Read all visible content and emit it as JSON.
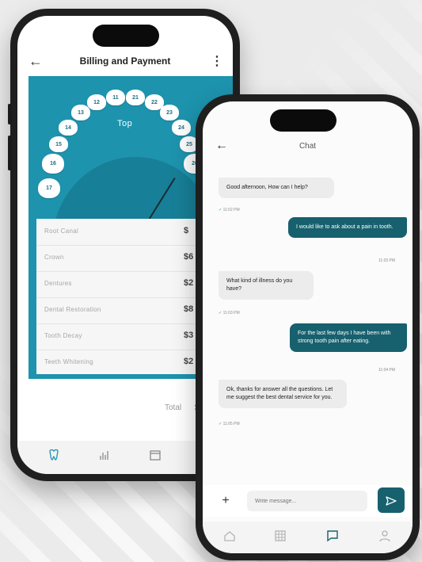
{
  "billing": {
    "title": "Billing and Payment",
    "back_icon": "arrow-left-icon",
    "more_icon": "more-vertical-icon",
    "jaw_label": "Top",
    "teeth": [
      "11",
      "12",
      "13",
      "14",
      "15",
      "16",
      "17",
      "21",
      "22",
      "23",
      "24",
      "25",
      "26"
    ],
    "services": [
      {
        "name": "Root Canal",
        "price": "$"
      },
      {
        "name": "Crown",
        "price": "$6"
      },
      {
        "name": "Dentures",
        "price": "$2"
      },
      {
        "name": "Dental Restoration",
        "price": "$8"
      },
      {
        "name": "Tooth Decay",
        "price": "$3"
      },
      {
        "name": "Teeth Whitening",
        "price": "$2"
      }
    ],
    "total_label": "Total",
    "total_value": "$1",
    "tab_icons": [
      "tooth-icon",
      "chart-icon",
      "calendar-icon"
    ],
    "accent_color": "#1d93ad"
  },
  "chat": {
    "title": "Chat",
    "back_icon": "arrow-left-icon",
    "messages": [
      {
        "from": "them",
        "text": "Good afternoon, How can I help?",
        "time": "11:02 PM"
      },
      {
        "from": "me",
        "text": "I would like to ask about a pain in tooth.",
        "time": "11:03 PM"
      },
      {
        "from": "them",
        "text": "What kind of illness do you have?",
        "time": "11:03 PM"
      },
      {
        "from": "me",
        "text": "For the last few days I have been with strong tooth pain after eating.",
        "time": "11:04 PM"
      },
      {
        "from": "them",
        "text": "Ok, thanks for answer all the questions. Let me suggest the best dental service for you.",
        "time": "11:05 PM"
      }
    ],
    "composer": {
      "placeholder": "Write message...",
      "plus_icon": "plus-icon",
      "send_icon": "send-icon"
    },
    "tab_icons": [
      "home-icon",
      "grid-icon",
      "chat-icon",
      "user-icon"
    ],
    "active_tab": "chat-icon",
    "bubble_color": "#17606e"
  }
}
